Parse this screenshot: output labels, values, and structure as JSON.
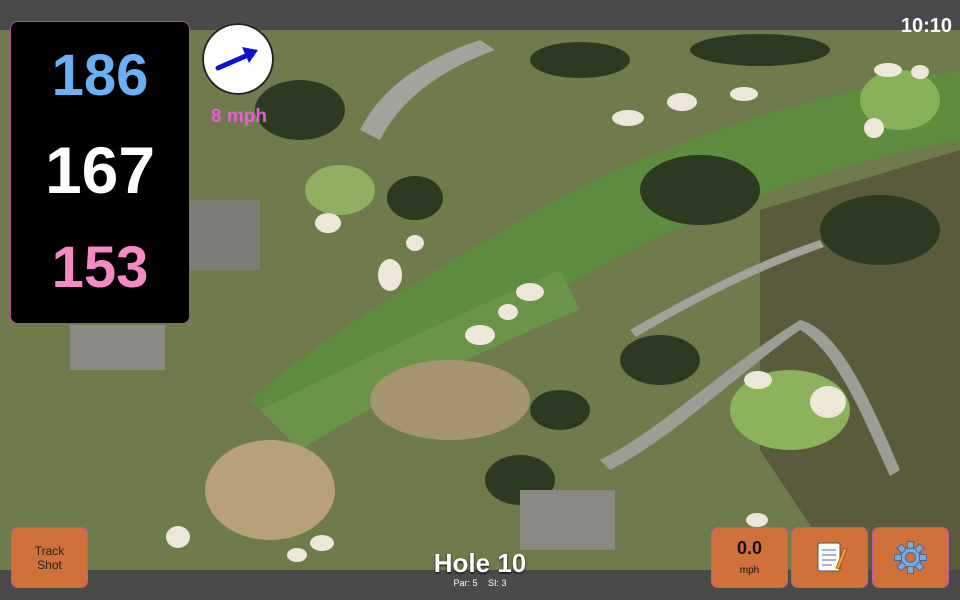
{
  "status": {
    "clock": "10:10"
  },
  "distances": {
    "back": "186",
    "center": "167",
    "front": "153"
  },
  "wind": {
    "speed_label": "8 mph",
    "icon": "wind-direction-arrow-icon"
  },
  "hole": {
    "title": "Hole 10",
    "par": "Par: 5",
    "si": "SI: 3"
  },
  "buttons": {
    "track_shot_line1": "Track",
    "track_shot_line2": "Shot",
    "speed_value": "0.0",
    "speed_unit": "mph",
    "notes_icon": "notepad-icon",
    "settings_icon": "gear-icon"
  },
  "colors": {
    "back": "#6ab0f5",
    "center": "#ffffff",
    "front": "#f58ac4",
    "button": "#d0703a",
    "wind_text": "#e85ed8"
  }
}
